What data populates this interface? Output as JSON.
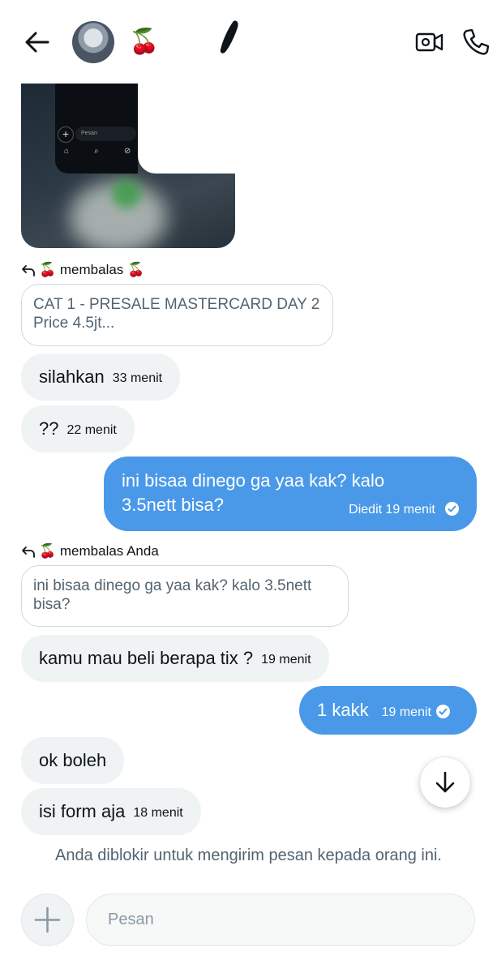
{
  "header": {
    "back_icon": "arrow-left-icon",
    "name_emoji": "🍒",
    "video_icon": "video-camera-icon",
    "phone_icon": "phone-icon"
  },
  "shared_image": {
    "input_placeholder": "Pesan",
    "plus": "+"
  },
  "reply1": {
    "label": "🍒 membalas 🍒"
  },
  "quote1": {
    "text": "CAT 1 - PRESALE MASTERCARD DAY 2 Price 4.5jt..."
  },
  "messages": [
    {
      "text": "silahkan",
      "time": "33 menit"
    },
    {
      "text": "??",
      "time": "22 menit"
    }
  ],
  "outgoing1": {
    "text": "ini bisaa dinego ga yaa kak? kalo 3.5nett bisa?",
    "time": "Diedit 19 menit"
  },
  "reply2": {
    "label": "🍒 membalas Anda"
  },
  "quote2": {
    "text": "ini bisaa dinego ga yaa kak? kalo 3.5nett bisa?"
  },
  "messages2": [
    {
      "text": "kamu mau beli berapa tix ?",
      "time": "19 menit"
    }
  ],
  "outgoing2": {
    "text": "1 kakk",
    "time": "19 menit"
  },
  "messages3": [
    {
      "text": "ok boleh",
      "time": ""
    },
    {
      "text": "isi form aja",
      "time": "18 menit"
    }
  ],
  "blocked_notice": "Anda diblokir untuk mengirim pesan kepada orang ini.",
  "composer": {
    "placeholder": "Pesan"
  },
  "colors": {
    "accent": "#4a99e9",
    "incoming_bg": "#eff3f4",
    "muted": "#536471"
  }
}
